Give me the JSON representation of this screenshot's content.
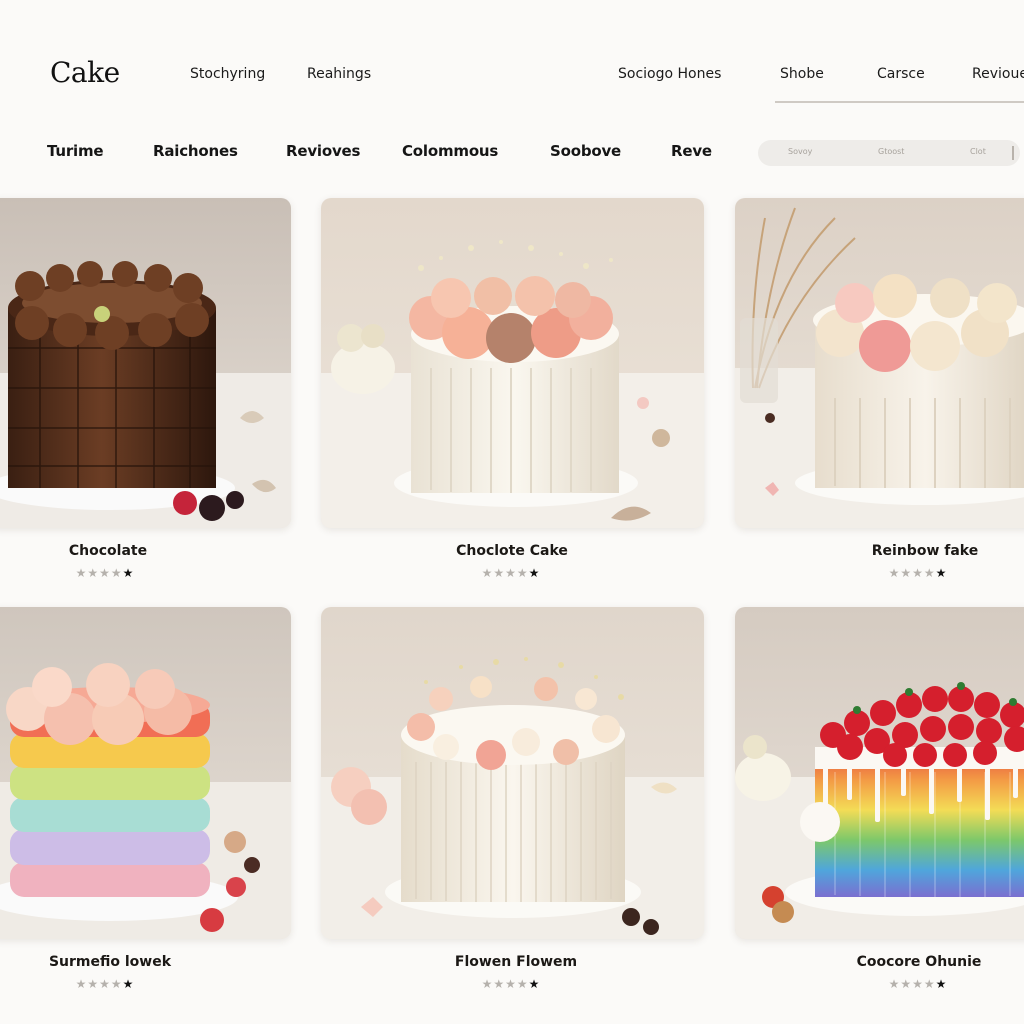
{
  "header": {
    "logo": "Cake",
    "left_links": [
      "Stochyring",
      "Reahings"
    ],
    "right_links": [
      "Sociogo Hones",
      "Shobe",
      "Carsce",
      "Revioue"
    ]
  },
  "categories": [
    "Turime",
    "Raichones",
    "Revioves",
    "Colommous",
    "Soobove",
    "Reve"
  ],
  "search": {
    "hints": [
      "Sovoy",
      "Gtoost",
      "Clot"
    ]
  },
  "cards": [
    {
      "title": "Chocolate",
      "rating": 5
    },
    {
      "title": "Choclote Cake",
      "rating": 5
    },
    {
      "title": "Reinbow fake",
      "rating": 5
    },
    {
      "title": "Surmefio lowek",
      "rating": 5
    },
    {
      "title": "Flowen Flowem",
      "rating": 5
    },
    {
      "title": "Coocore Ohunie",
      "rating": 5
    }
  ],
  "colors": {
    "accent": "#1d1b19",
    "background": "#fbfaf8",
    "star_filled": "#111111",
    "star_empty": "#b5b1ac"
  },
  "icons": {
    "rating": "star-icon"
  }
}
